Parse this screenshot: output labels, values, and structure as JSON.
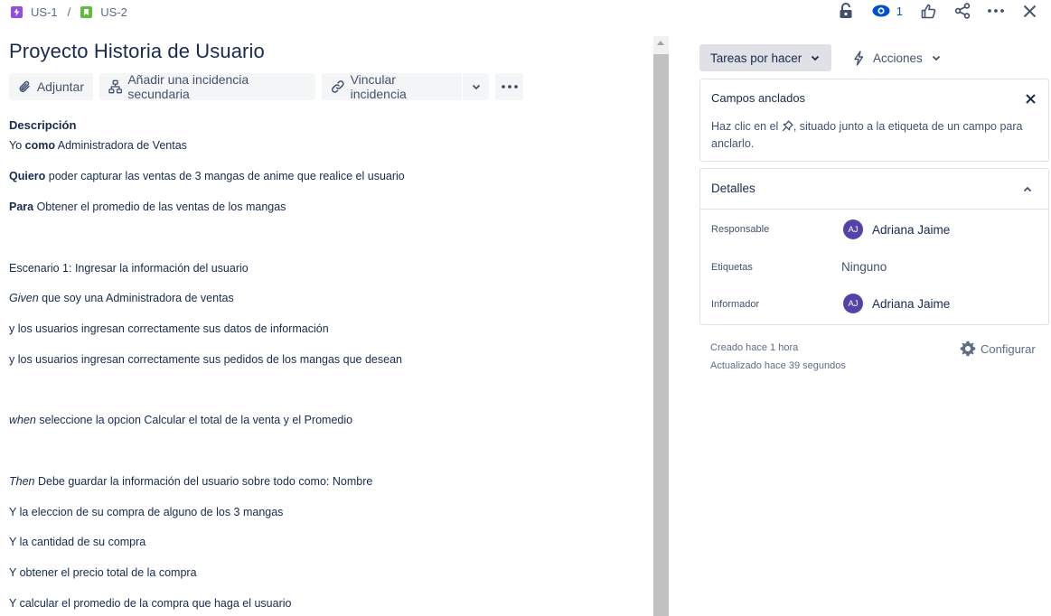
{
  "breadcrumb": {
    "items": [
      {
        "label": "US-1",
        "icon": "epic-icon",
        "color": "#904ee2"
      },
      {
        "label": "US-2",
        "icon": "story-icon",
        "color": "#63ba3c"
      }
    ],
    "separator": "/"
  },
  "topbar": {
    "watch_count": "1",
    "icons": [
      "lock-icon",
      "watch-icon",
      "like-icon",
      "share-icon",
      "more-icon",
      "close-icon"
    ]
  },
  "issue": {
    "title": "Proyecto Historia de Usuario"
  },
  "toolbar": {
    "attach_label": "Adjuntar",
    "add_child_label": "Añadir una incidencia secundaria",
    "link_label": "Vincular incidencia"
  },
  "description": {
    "label": "Descripción",
    "line1": {
      "pre": "Yo ",
      "bold": "como",
      "post": " Administradora de Ventas"
    },
    "line2": {
      "bold": "Quiero",
      "post": " poder capturar las ventas de 3 mangas de anime que realice el usuario"
    },
    "line3": {
      "bold": "Para",
      "post": " Obtener el promedio de las ventas de los mangas"
    },
    "line4": "Escenario 1: Ingresar la información del usuario",
    "line5": {
      "italic": "Given",
      "post": " que soy una Administradora de ventas"
    },
    "line6": "y los usuarios ingresan correctamente sus datos de información",
    "line7": "y los usuarios ingresan correctamente sus pedidos de los mangas que desean",
    "line8": {
      "italic": "when",
      "post": " seleccione la opcion Calcular el total de la venta y el Promedio"
    },
    "line9": {
      "italic": "Then",
      "post": " Debe guardar la información del usuario sobre todo como: Nombre"
    },
    "line10": "Y la eleccion de su compra de alguno de los 3 mangas",
    "line11": "Y la cantidad de su compra",
    "line12": "Y obtener el precio total de  la compra",
    "line13": "Y calcular el promedio de la compra que haga el usuario"
  },
  "sidebar": {
    "status_label": "Tareas por hacer",
    "actions_label": "Acciones",
    "pinned": {
      "title": "Campos anclados",
      "text_pre": "Haz clic en el ",
      "text_post": ", situado junto a la etiqueta de un campo para anclarlo."
    },
    "details": {
      "title": "Detalles",
      "assignee_label": "Responsable",
      "assignee_initials": "AJ",
      "assignee_name": "Adriana Jaime",
      "labels_label": "Etiquetas",
      "labels_value": "Ninguno",
      "reporter_label": "Informador",
      "reporter_initials": "AJ",
      "reporter_name": "Adriana Jaime"
    },
    "created": "Creado hace 1 hora",
    "updated": "Actualizado hace 39 segundos",
    "configure_label": "Configurar"
  },
  "colors": {
    "avatar": "#5243aa",
    "watch_icon": "#0052cc",
    "status_bg": "#dfe1e6"
  }
}
